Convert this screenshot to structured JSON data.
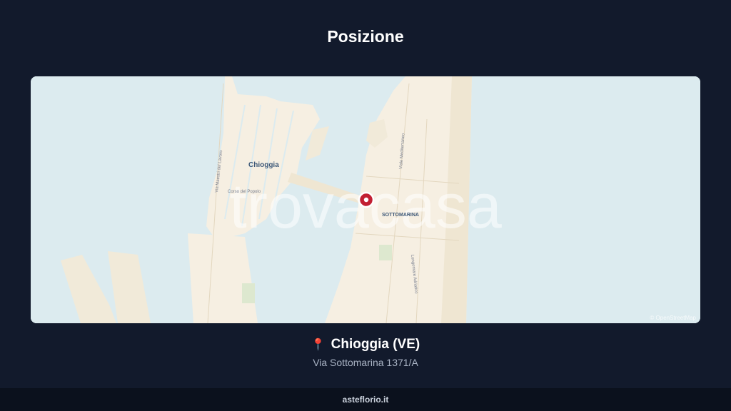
{
  "header": {
    "title": "Posizione"
  },
  "map": {
    "labels": {
      "city": "Chioggia",
      "district": "SOTTOMARINA",
      "street_1": "Via Maestri del Lavoro",
      "street_2": "Lungomare Adriatico",
      "street_3": "Viale Mediterraneo",
      "street_4": "Corso del Popolo"
    },
    "watermark": "trovacasa",
    "attribution": "© OpenStreetMap",
    "colors": {
      "water": "#dcebef",
      "land": "#f6efe2",
      "marker": "#c21f32"
    }
  },
  "location": {
    "icon": "📍",
    "city": "Chioggia (VE)",
    "address": "Via Sottomarina 1371/A"
  },
  "footer": {
    "site": "asteflorio.it"
  }
}
